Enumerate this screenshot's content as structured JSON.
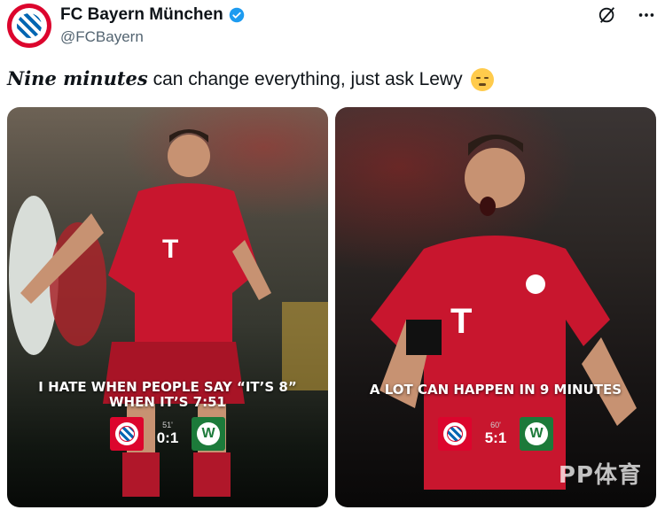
{
  "account": {
    "display_name": "FC Bayern München",
    "handle": "@FCBayern",
    "verified": true
  },
  "tweet": {
    "text_emphasis": "Nine minutes",
    "text_rest": " can change everything, just ask Lewy",
    "emoji": "disappointed-face"
  },
  "top_icons": [
    "grok-icon",
    "more-icon"
  ],
  "media": [
    {
      "caption_line1": "I HATE WHEN PEOPLE SAY “IT’S 8”",
      "caption_line2": "WHEN IT’S 7:51",
      "minute": "51'",
      "score": "0:1",
      "home_badge": "bayern-crest",
      "away_badge": "wolfsburg-crest"
    },
    {
      "caption_line1": "A LOT CAN HAPPEN IN 9 MINUTES",
      "minute": "60'",
      "score": "5:1",
      "home_badge": "bayern-crest",
      "away_badge": "wolfsburg-crest",
      "watermark": "PP体育"
    }
  ],
  "colors": {
    "bayern_red": "#dc052d",
    "wolfsburg_green": "#1c7a3a",
    "verified_blue": "#1d9bf0"
  }
}
